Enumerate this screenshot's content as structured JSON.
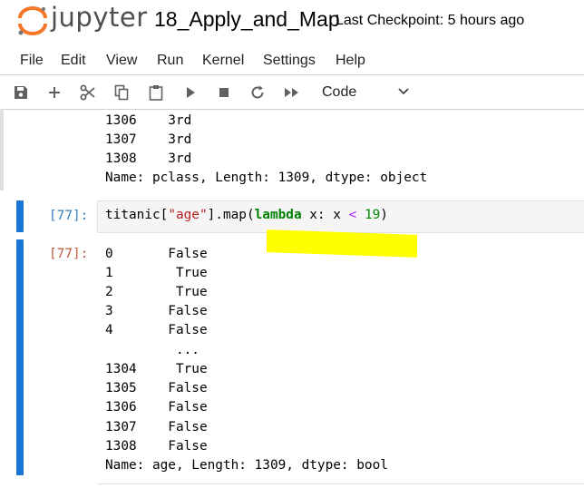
{
  "header": {
    "logo_text": "jupyter",
    "notebook_title": "18_Apply_and_Map",
    "checkpoint": "Last Checkpoint: 5 hours ago"
  },
  "menu": [
    "File",
    "Edit",
    "View",
    "Run",
    "Kernel",
    "Settings",
    "Help"
  ],
  "toolbar": {
    "icons": [
      "save-icon",
      "add-icon",
      "cut-icon",
      "copy-icon",
      "paste-icon",
      "run-icon",
      "stop-icon",
      "restart-icon",
      "fast-forward-icon"
    ],
    "cell_type": "Code"
  },
  "prev_output": {
    "lines": [
      "1306    3rd",
      "1307    3rd",
      "1308    3rd",
      "Name: pclass, Length: 1309, dtype: object"
    ]
  },
  "input_cell": {
    "prompt": "[77]:",
    "code_parts": {
      "p1": "titanic[",
      "p2": "\"age\"",
      "p3": "].map(",
      "p4": "lambda",
      "p5": " x: x ",
      "p6": "<",
      "p7": " ",
      "p8": "19",
      "p9": ")"
    }
  },
  "output_cell": {
    "prompt": "[77]:",
    "lines": [
      "0       False",
      "1        True",
      "2        True",
      "3       False",
      "4       False",
      "         ...",
      "1304     True",
      "1305    False",
      "1306    False",
      "1307    False",
      "1308    False",
      "Name: age, Length: 1309, dtype: bool"
    ]
  },
  "colors": {
    "accent": "#1976d2",
    "in_prompt": "#307fc1",
    "out_prompt": "#bf5b3d",
    "keyword": "#008000",
    "string": "#ba2121",
    "operator": "#aa22ff",
    "highlight": "#ffff00"
  }
}
